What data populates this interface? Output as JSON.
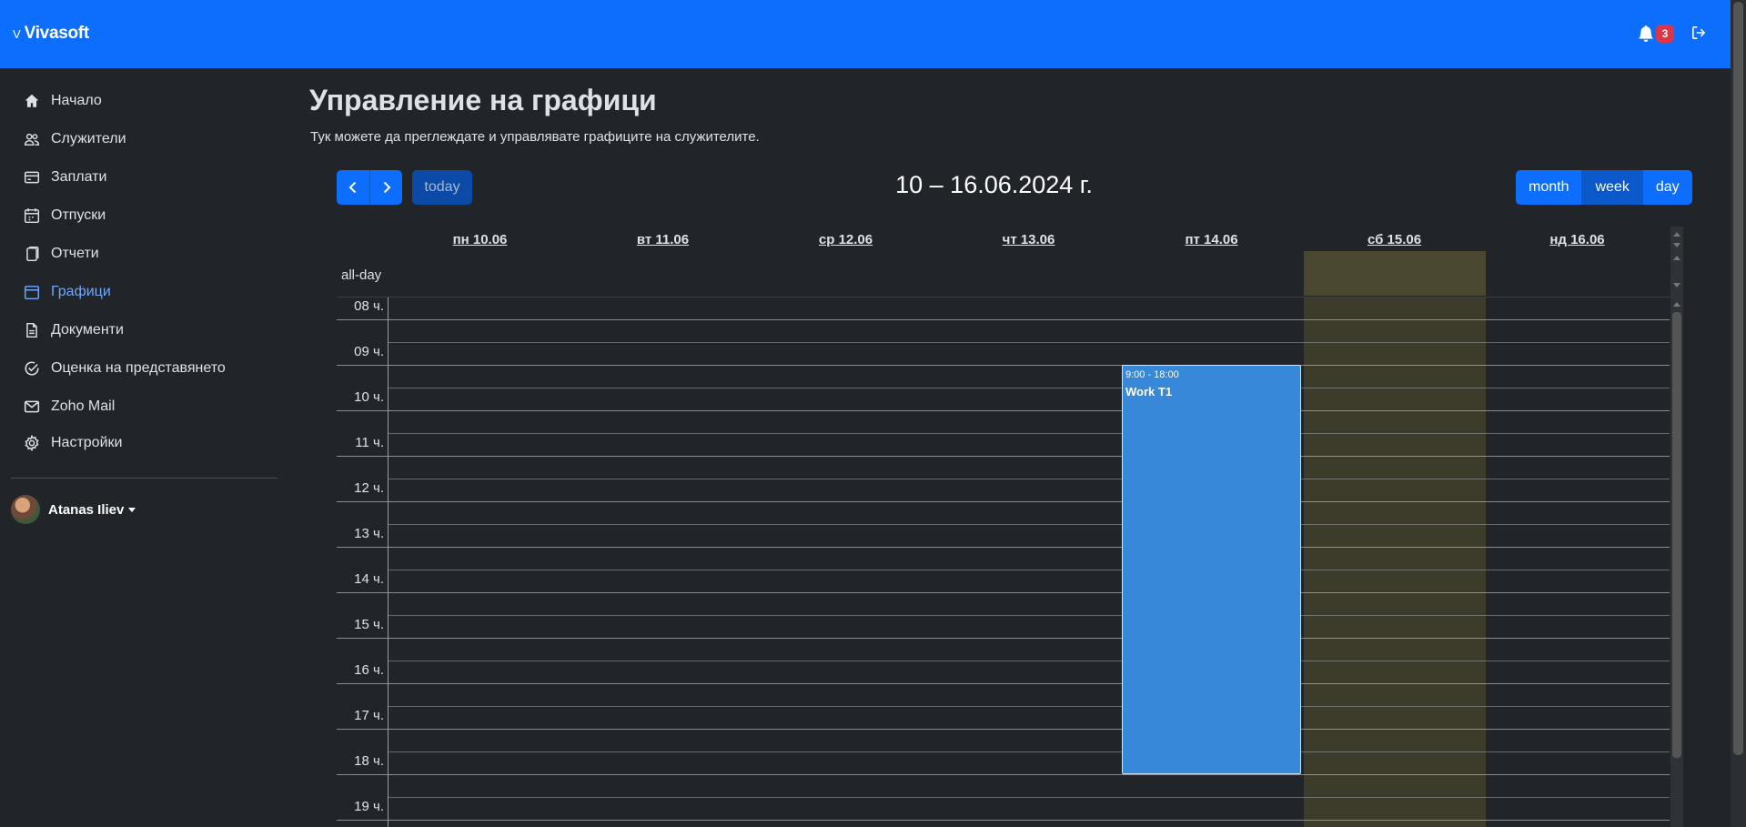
{
  "app": {
    "brand_mark": "V",
    "brand_name": "Vivasoft"
  },
  "header": {
    "notification_count": "3"
  },
  "sidebar": {
    "items": [
      {
        "label": "Начало",
        "icon": "home-icon"
      },
      {
        "label": "Служители",
        "icon": "users-icon"
      },
      {
        "label": "Заплати",
        "icon": "credit-card-icon"
      },
      {
        "label": "Отпуски",
        "icon": "calendar-icon"
      },
      {
        "label": "Отчети",
        "icon": "document-icon"
      },
      {
        "label": "Графици",
        "icon": "calendar-icon",
        "active": true
      },
      {
        "label": "Документи",
        "icon": "file-icon"
      },
      {
        "label": "Оценка на представянето",
        "icon": "check-circle-icon"
      },
      {
        "label": "Zoho Mail",
        "icon": "envelope-icon"
      },
      {
        "label": "Настройки",
        "icon": "gear-icon"
      }
    ],
    "user": {
      "name": "Atanas Iliev"
    }
  },
  "main": {
    "title": "Управление на графици",
    "subtitle": "Тук можете да преглеждате и управлявате графиците на служителите."
  },
  "calendar": {
    "range_title": "10 – 16.06.2024 г.",
    "today_label": "today",
    "views": [
      {
        "label": "month"
      },
      {
        "label": "week"
      },
      {
        "label": "day"
      }
    ],
    "days": [
      "пн 10.06",
      "вт 11.06",
      "ср 12.06",
      "чт 13.06",
      "пт 14.06",
      "сб 15.06",
      "нд 16.06"
    ],
    "allday_label": "all-day",
    "hours": [
      "08 ч.",
      "09 ч.",
      "10 ч.",
      "11 ч.",
      "12 ч.",
      "13 ч.",
      "14 ч.",
      "15 ч.",
      "16 ч.",
      "17 ч.",
      "18 ч.",
      "19 ч."
    ],
    "event": {
      "time": "9:00 - 18:00",
      "title": "Work T1",
      "color": "#3788d8"
    }
  },
  "colors": {
    "topbar": "#0d6efd",
    "background": "#212529",
    "accent": "#6ea8fe",
    "weekend": "#3d3c2a"
  }
}
